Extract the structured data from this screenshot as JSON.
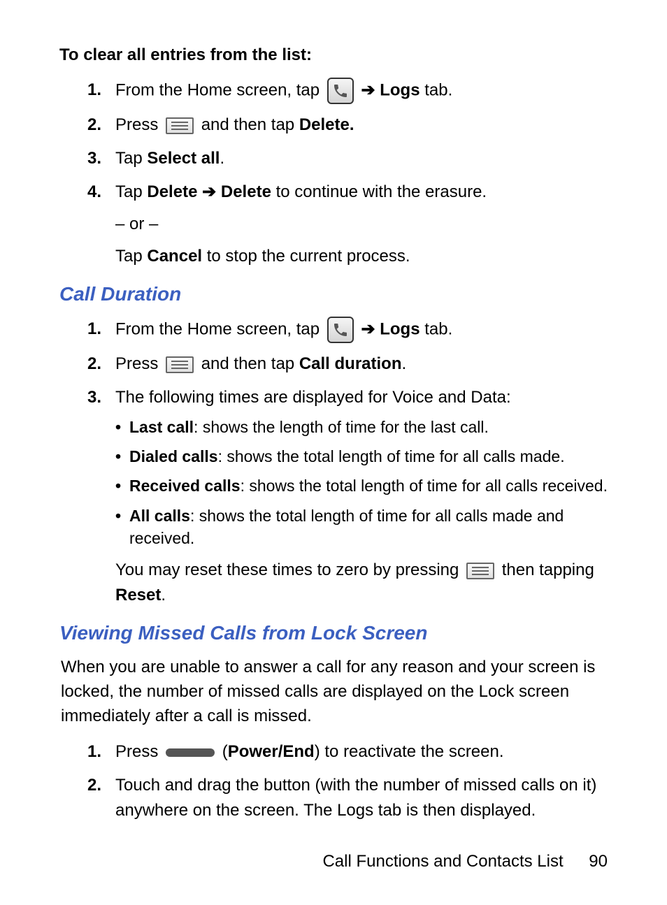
{
  "section1": {
    "title": "To clear all entries from the list:",
    "step1_a": "From the Home screen, tap ",
    "step1_logs": "Logs",
    "step1_c": " tab.",
    "step2_a": "Press ",
    "step2_b": " and then tap ",
    "step2_delete": "Delete.",
    "step3_a": "Tap ",
    "step3_selectall": "Select all",
    "step3_c": ".",
    "step4_a": "Tap ",
    "step4_delete1": "Delete",
    "step4_delete2": "Delete",
    "step4_c": " to continue with the erasure.",
    "step4_or": "– or –",
    "step4_d": "Tap ",
    "step4_cancel": "Cancel",
    "step4_e": " to stop the current process."
  },
  "section2": {
    "heading": "Call Duration",
    "step1_a": "From the Home screen, tap ",
    "step1_logs": "Logs",
    "step1_c": " tab.",
    "step2_a": "Press ",
    "step2_b": " and then tap ",
    "step2_calldur": "Call duration",
    "step2_c": ".",
    "step3_a": "The following times are displayed for Voice and Data:",
    "bullets": {
      "b1_bold": "Last call",
      "b1_rest": ": shows the length of time for the last call.",
      "b2_bold": "Dialed calls",
      "b2_rest": ": shows the total length of time for all calls made.",
      "b3_bold": "Received calls",
      "b3_rest": ": shows the total length of time for all calls received.",
      "b4_bold": "All calls",
      "b4_rest": ": shows the total length of time for all calls made and received."
    },
    "reset_a": "You may reset these times to zero by pressing ",
    "reset_b": " then tapping ",
    "reset_bold": "Reset",
    "reset_c": "."
  },
  "section3": {
    "heading": "Viewing Missed Calls from Lock Screen",
    "paragraph": "When you are unable to answer a call for any reason and your screen is locked, the number of missed calls are displayed on the Lock screen immediately after a call is missed.",
    "step1_a": "Press ",
    "step1_b": " (",
    "step1_power": "Power/End",
    "step1_c": ") to reactivate the screen.",
    "step2": "Touch and drag the button (with the number of missed calls on it) anywhere on the screen. The Logs tab is then displayed."
  },
  "footer": {
    "label": "Call Functions and Contacts List",
    "page": "90"
  },
  "arrow": "➔",
  "nums": {
    "n1": "1.",
    "n2": "2.",
    "n3": "3.",
    "n4": "4."
  }
}
